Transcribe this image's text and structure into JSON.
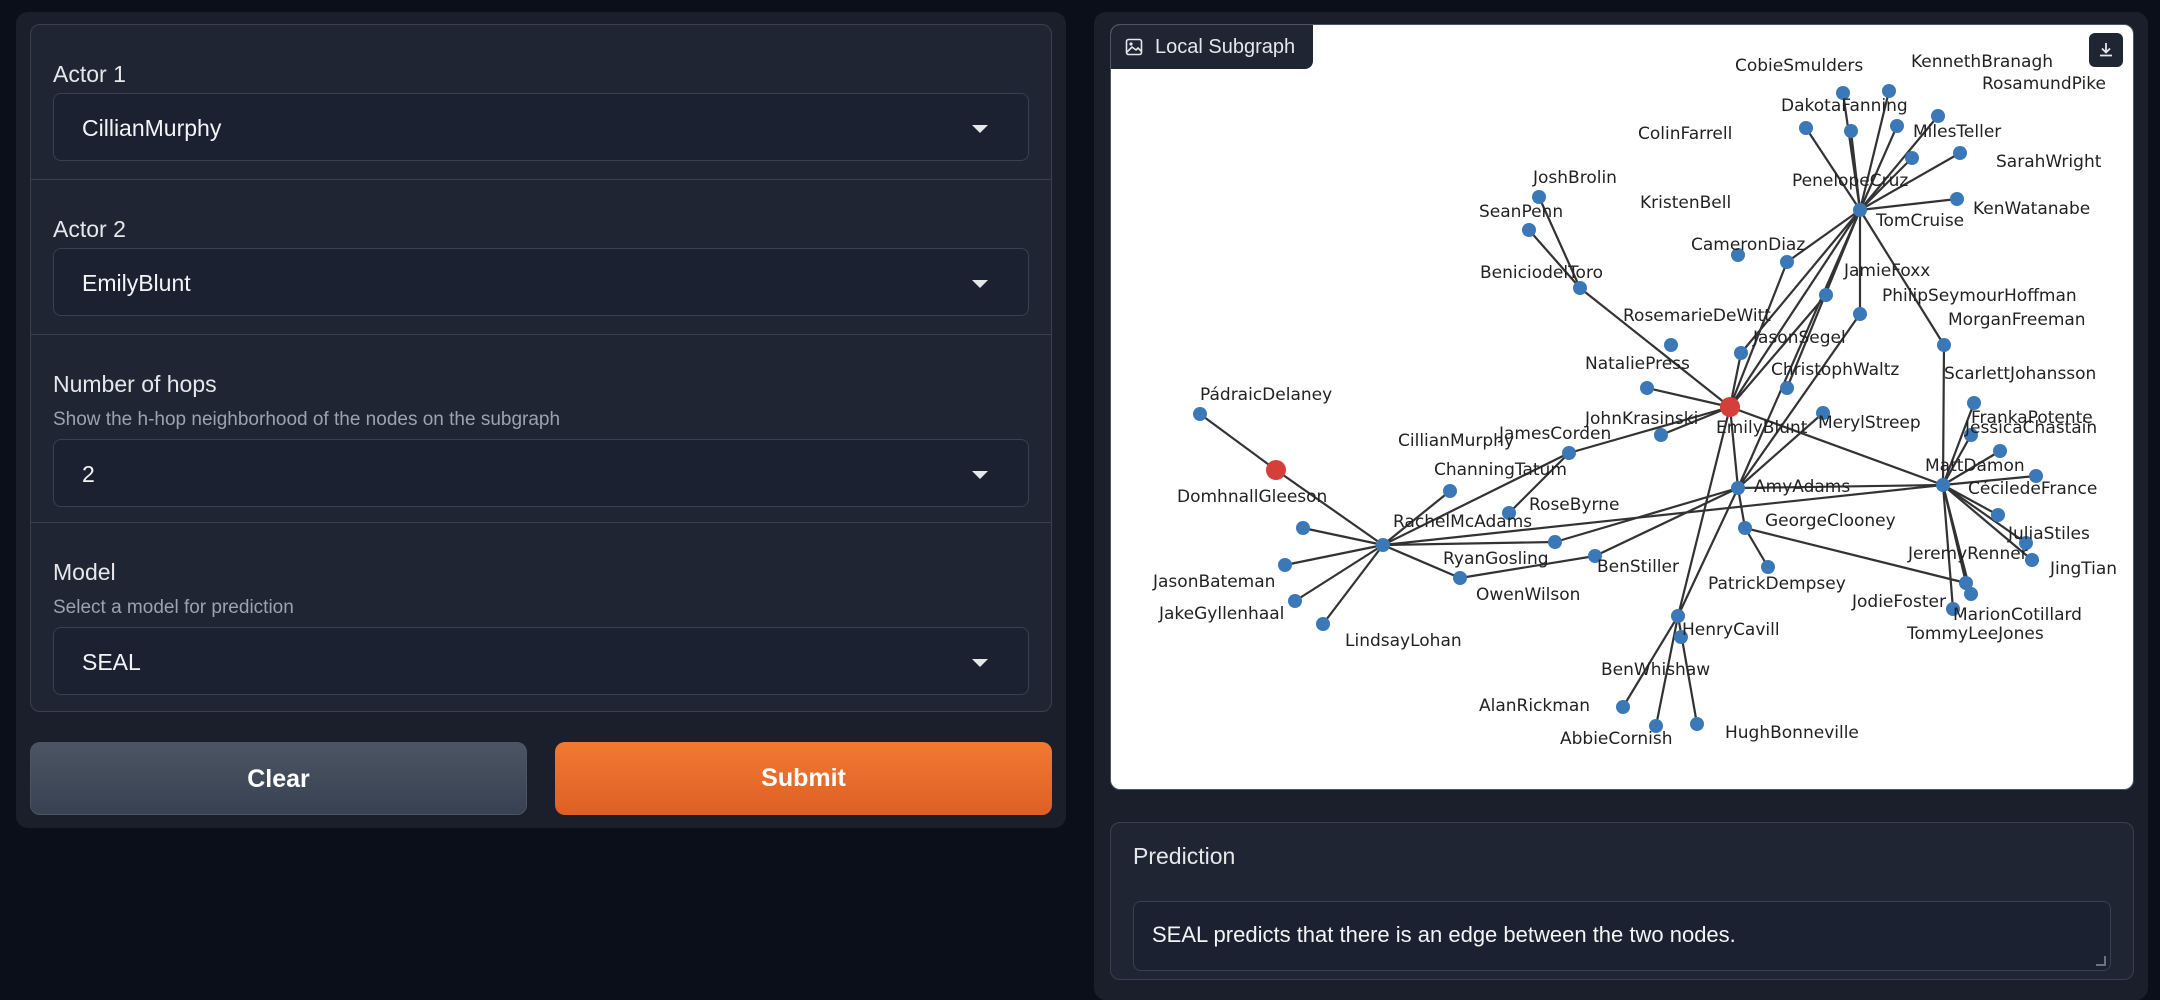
{
  "form": {
    "actor1": {
      "label": "Actor 1",
      "value": "CillianMurphy"
    },
    "actor2": {
      "label": "Actor 2",
      "value": "EmilyBlunt"
    },
    "hops": {
      "label": "Number of hops",
      "info": "Show the h-hop neighborhood of the nodes on the subgraph",
      "value": "2"
    },
    "model": {
      "label": "Model",
      "info": "Select a model for prediction",
      "value": "SEAL"
    }
  },
  "buttons": {
    "clear": "Clear",
    "submit": "Submit"
  },
  "graph": {
    "title": "Local Subgraph",
    "colors": {
      "node": "#3b78b8",
      "highlight": "#d43f3a",
      "edge": "#333333"
    }
  },
  "prediction": {
    "label": "Prediction",
    "text": "SEAL predicts that there is an edge between the two nodes."
  },
  "nodes": [
    {
      "id": "CillianMurphy",
      "label": "CillianMurphy",
      "hl": true
    },
    {
      "id": "EmilyBlunt",
      "label": "EmilyBlunt",
      "hl": true
    },
    {
      "id": "TomCruise",
      "label": "TomCruise"
    },
    {
      "id": "MattDamon",
      "label": "MattDamon"
    },
    {
      "id": "RachelMcAdams",
      "label": "RachelMcAdams"
    },
    {
      "id": "AmyAdams",
      "label": "AmyAdams"
    },
    {
      "id": "HenryCavill",
      "label": "HenryCavill"
    },
    {
      "id": "PadraicDelaney",
      "label": "PádraicDelaney"
    },
    {
      "id": "CobieSmulders",
      "label": "CobieSmulders"
    },
    {
      "id": "DakotaFanning",
      "label": "DakotaFanning"
    },
    {
      "id": "KennethBranagh",
      "label": "KennethBranagh"
    },
    {
      "id": "RosamundPike",
      "label": "RosamundPike"
    },
    {
      "id": "ColinFarrell",
      "label": "ColinFarrell"
    },
    {
      "id": "MilesTeller",
      "label": "MilesTeller"
    },
    {
      "id": "SarahWright",
      "label": "SarahWright"
    },
    {
      "id": "PenelopeCruz",
      "label": "PenelopeCruz"
    },
    {
      "id": "KenWatanabe",
      "label": "KenWatanabe"
    },
    {
      "id": "JoshBrolin",
      "label": "JoshBrolin"
    },
    {
      "id": "SeanPenn",
      "label": "SeanPenn"
    },
    {
      "id": "KristenBell",
      "label": "KristenBell"
    },
    {
      "id": "CameronDiaz",
      "label": "CameronDiaz"
    },
    {
      "id": "BeniciodelToro",
      "label": "BeniciodelToro"
    },
    {
      "id": "JamieFoxx",
      "label": "JamieFoxx"
    },
    {
      "id": "PhilipSeymourHoffman",
      "label": "PhilipSeymourHoffman"
    },
    {
      "id": "RosemarieDeWitt",
      "label": "RosemarieDeWitt"
    },
    {
      "id": "MorganFreeman",
      "label": "MorganFreeman"
    },
    {
      "id": "JasonSegel",
      "label": "JasonSegel"
    },
    {
      "id": "NataliePress",
      "label": "NataliePress"
    },
    {
      "id": "ScarlettJohansson",
      "label": "ScarlettJohansson"
    },
    {
      "id": "ChristophWaltz",
      "label": "ChristophWaltz"
    },
    {
      "id": "FrankaPotente",
      "label": "FrankaPotente"
    },
    {
      "id": "JohnKrasinski",
      "label": "JohnKrasinski"
    },
    {
      "id": "MerylStreep",
      "label": "MerylStreep"
    },
    {
      "id": "JessicaChastain",
      "label": "JessicaChastain"
    },
    {
      "id": "JamesCorden",
      "label": "JamesCorden"
    },
    {
      "id": "ChanningTatum",
      "label": "ChanningTatum"
    },
    {
      "id": "CeciledeFrance",
      "label": "CéciledeFrance"
    },
    {
      "id": "DomhnallGleeson",
      "label": "DomhnallGleeson"
    },
    {
      "id": "RoseByrne",
      "label": "RoseByrne"
    },
    {
      "id": "GeorgeClooney",
      "label": "GeorgeClooney"
    },
    {
      "id": "JuliaStiles",
      "label": "JuliaStiles"
    },
    {
      "id": "RyanGosling",
      "label": "RyanGosling"
    },
    {
      "id": "JeremyRenner",
      "label": "JeremyRenner"
    },
    {
      "id": "JingTian",
      "label": "JingTian"
    },
    {
      "id": "JasonBateman",
      "label": "JasonBateman"
    },
    {
      "id": "BenStiller",
      "label": "BenStiller"
    },
    {
      "id": "PatrickDempsey",
      "label": "PatrickDempsey"
    },
    {
      "id": "OwenWilson",
      "label": "OwenWilson"
    },
    {
      "id": "JodieFoster",
      "label": "JodieFoster"
    },
    {
      "id": "MarionCotillard",
      "label": "MarionCotillard"
    },
    {
      "id": "JakeGyllenhaal",
      "label": "JakeGyllenhaal"
    },
    {
      "id": "TommyLeeJones",
      "label": "TommyLeeJones"
    },
    {
      "id": "LindsayLohan",
      "label": "LindsayLohan"
    },
    {
      "id": "BenWhishaw",
      "label": "BenWhishaw"
    },
    {
      "id": "AlanRickman",
      "label": "AlanRickman"
    },
    {
      "id": "AbbieCornish",
      "label": "AbbieCornish"
    },
    {
      "id": "HughBonneville",
      "label": "HughBonneville"
    }
  ],
  "edges": [
    [
      "CillianMurphy",
      "PadraicDelaney"
    ],
    [
      "CillianMurphy",
      "RachelMcAdams"
    ],
    [
      "RachelMcAdams",
      "DomhnallGleeson"
    ],
    [
      "RachelMcAdams",
      "JasonBateman"
    ],
    [
      "RachelMcAdams",
      "JakeGyllenhaal"
    ],
    [
      "RachelMcAdams",
      "LindsayLohan"
    ],
    [
      "RachelMcAdams",
      "OwenWilson"
    ],
    [
      "RachelMcAdams",
      "ChanningTatum"
    ],
    [
      "RachelMcAdams",
      "RyanGosling"
    ],
    [
      "RachelMcAdams",
      "JamesCorden"
    ],
    [
      "RachelMcAdams",
      "MattDamon"
    ],
    [
      "EmilyBlunt",
      "JamesCorden"
    ],
    [
      "EmilyBlunt",
      "JohnKrasinski"
    ],
    [
      "EmilyBlunt",
      "NataliePress"
    ],
    [
      "EmilyBlunt",
      "BeniciodelToro"
    ],
    [
      "EmilyBlunt",
      "CameronDiaz"
    ],
    [
      "EmilyBlunt",
      "TomCruise"
    ],
    [
      "EmilyBlunt",
      "MattDamon"
    ],
    [
      "EmilyBlunt",
      "AmyAdams"
    ],
    [
      "EmilyBlunt",
      "HenryCavill"
    ],
    [
      "EmilyBlunt",
      "JasonSegel"
    ],
    [
      "EmilyBlunt",
      "JamieFoxx"
    ],
    [
      "BeniciodelToro",
      "JoshBrolin"
    ],
    [
      "BeniciodelToro",
      "SeanPenn"
    ],
    [
      "TomCruise",
      "CobieSmulders"
    ],
    [
      "TomCruise",
      "DakotaFanning"
    ],
    [
      "TomCruise",
      "KennethBranagh"
    ],
    [
      "TomCruise",
      "RosamundPike"
    ],
    [
      "TomCruise",
      "ColinFarrell"
    ],
    [
      "TomCruise",
      "MilesTeller"
    ],
    [
      "TomCruise",
      "SarahWright"
    ],
    [
      "TomCruise",
      "PenelopeCruz"
    ],
    [
      "TomCruise",
      "KenWatanabe"
    ],
    [
      "TomCruise",
      "CameronDiaz"
    ],
    [
      "TomCruise",
      "JasonSegel"
    ],
    [
      "TomCruise",
      "MorganFreeman"
    ],
    [
      "TomCruise",
      "PhilipSeymourHoffman"
    ],
    [
      "TomCruise",
      "AmyAdams"
    ],
    [
      "TomCruise",
      "ChristophWaltz"
    ],
    [
      "MattDamon",
      "MorganFreeman"
    ],
    [
      "MattDamon",
      "ScarlettJohansson"
    ],
    [
      "MattDamon",
      "JessicaChastain"
    ],
    [
      "MattDamon",
      "FrankaPotente"
    ],
    [
      "MattDamon",
      "CeciledeFrance"
    ],
    [
      "MattDamon",
      "JuliaStiles"
    ],
    [
      "MattDamon",
      "JingTian"
    ],
    [
      "MattDamon",
      "JeremyRenner"
    ],
    [
      "MattDamon",
      "MarionCotillard"
    ],
    [
      "MattDamon",
      "JodieFoster"
    ],
    [
      "MattDamon",
      "TommyLeeJones"
    ],
    [
      "MattDamon",
      "AmyAdams"
    ],
    [
      "AmyAdams",
      "MerylStreep"
    ],
    [
      "AmyAdams",
      "PhilipSeymourHoffman"
    ],
    [
      "AmyAdams",
      "GeorgeClooney"
    ],
    [
      "AmyAdams",
      "BenStiller"
    ],
    [
      "AmyAdams",
      "HenryCavill"
    ],
    [
      "AmyAdams",
      "RyanGosling"
    ],
    [
      "GeorgeClooney",
      "PatrickDempsey"
    ],
    [
      "GeorgeClooney",
      "JodieFoster"
    ],
    [
      "HenryCavill",
      "AlanRickman"
    ],
    [
      "HenryCavill",
      "AbbieCornish"
    ],
    [
      "HenryCavill",
      "HughBonneville"
    ],
    [
      "JamesCorden",
      "RoseByrne"
    ],
    [
      "BenStiller",
      "OwenWilson"
    ]
  ]
}
